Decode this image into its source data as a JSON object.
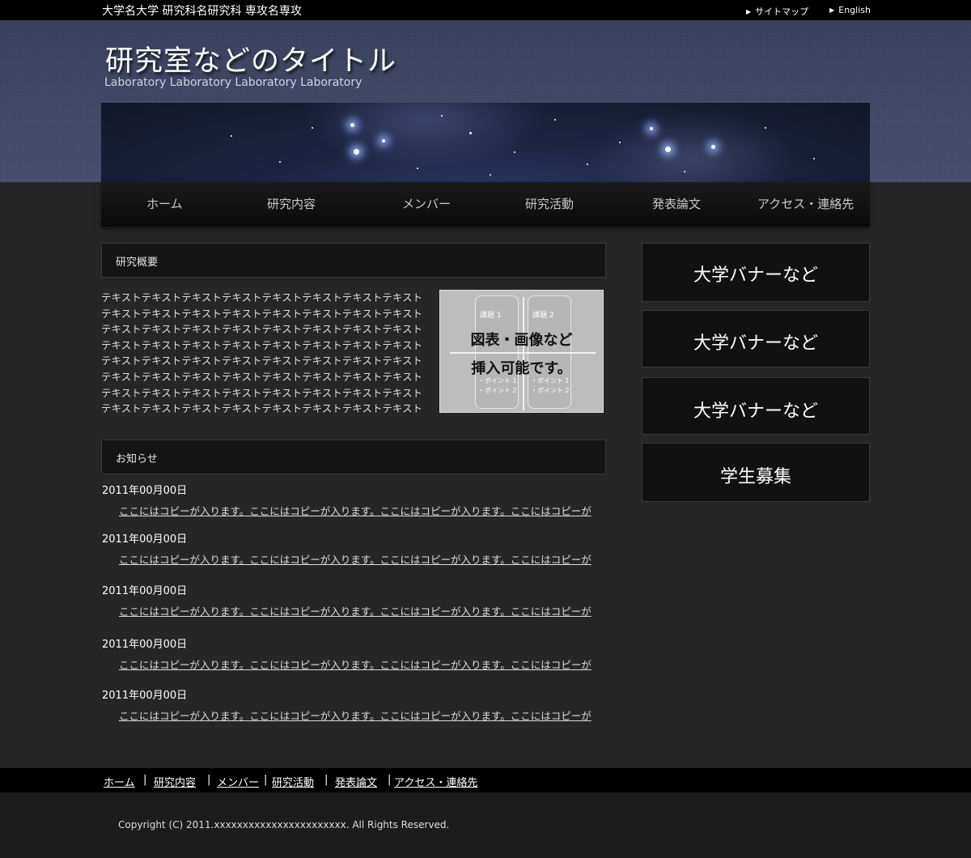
{
  "topbar": {
    "university": "大学名大学 研究科名研究科 専攻名専攻",
    "sitemap": "サイトマップ",
    "english": "English"
  },
  "header": {
    "title": "研究室などのタイトル",
    "subtitle": "Laboratory Laboratory Laboratory Laboratory"
  },
  "nav": [
    "ホーム",
    "研究内容",
    "メンバー",
    "研究活動",
    "発表論文",
    "アクセス・連絡先"
  ],
  "overview": {
    "heading": "研究概要",
    "lines": [
      "テキストテキストテキストテキストテキストテキストテキストテキスト",
      "テキストテキストテキストテキストテキストテキストテキストテキスト",
      "テキストテキストテキストテキストテキストテキストテキストテキスト",
      "テキストテキストテキストテキストテキストテキストテキストテキスト",
      "テキストテキストテキストテキストテキストテキストテキストテキスト",
      "テキストテキストテキストテキストテキストテキストテキストテキスト",
      "テキストテキストテキストテキストテキストテキストテキストテキスト",
      "テキストテキストテキストテキストテキストテキストテキストテキスト"
    ],
    "figure": {
      "line1": "図表・画像など",
      "line2": "挿入可能です。",
      "topic1": "課題 1",
      "topic2": "課題 2",
      "point1": "・ポイント 1",
      "point2": "・ポイント 2"
    }
  },
  "news": {
    "heading": "お知らせ",
    "items": [
      {
        "date": "2011年00月00日",
        "text": "ここにはコピーが入ります。ここにはコピーが入ります。ここにはコピーが入ります。ここにはコピーが"
      },
      {
        "date": "2011年00月00日",
        "text": "ここにはコピーが入ります。ここにはコピーが入ります。ここにはコピーが入ります。ここにはコピーが"
      },
      {
        "date": "2011年00月00日",
        "text": "ここにはコピーが入ります。ここにはコピーが入ります。ここにはコピーが入ります。ここにはコピーが"
      },
      {
        "date": "2011年00月00日",
        "text": "ここにはコピーが入ります。ここにはコピーが入ります。ここにはコピーが入ります。ここにはコピーが"
      },
      {
        "date": "2011年00月00日",
        "text": "ここにはコピーが入ります。ここにはコピーが入ります。ここにはコピーが入ります。ここにはコピーが"
      }
    ]
  },
  "sidebar": [
    "大学バナーなど",
    "大学バナーなど",
    "大学バナーなど",
    "学生募集"
  ],
  "footer_nav": {
    "links": [
      "ホーム",
      "研究内容",
      "メンバー",
      "研究活動",
      "発表論文",
      "アクセス・連絡先"
    ],
    "separator": "|"
  },
  "copyright": "Copyright (C) 2011.xxxxxxxxxxxxxxxxxxxxxxx. All Rights Reserved."
}
